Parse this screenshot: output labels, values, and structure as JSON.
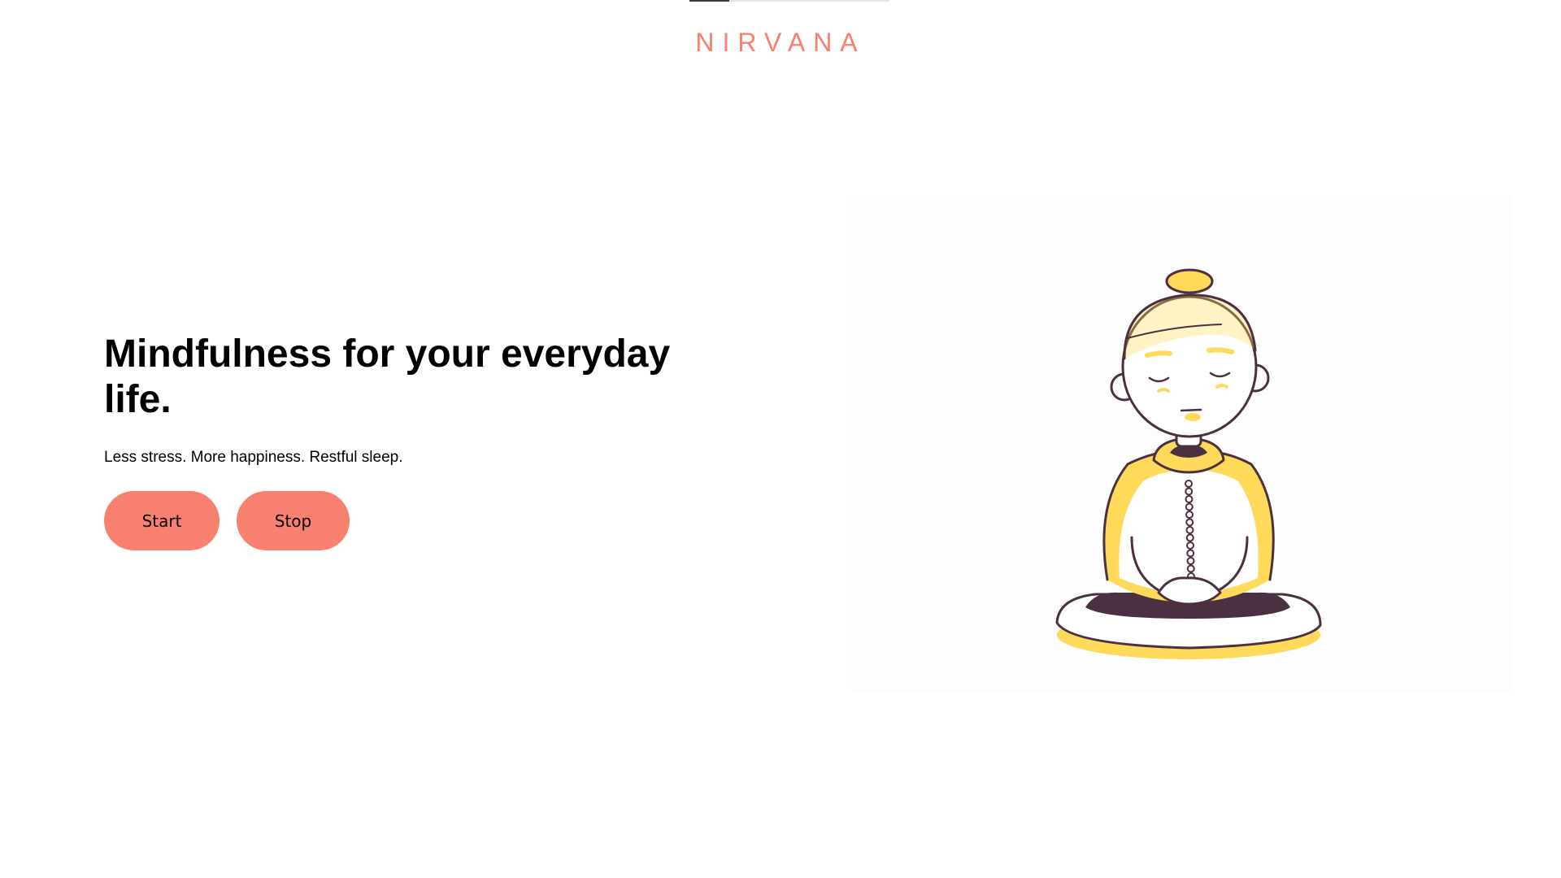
{
  "header": {
    "brand": "NIRVANA",
    "progress": 0.2
  },
  "hero": {
    "title": "Mindfulness for your everyday life.",
    "subtitle": "Less stress. More happiness. Restful sleep."
  },
  "actions": {
    "start_label": "Start",
    "stop_label": "Stop"
  },
  "illustration": {
    "icon": "meditating-person-icon"
  },
  "colors": {
    "accent": "#f88070",
    "illustration_yellow": "#ffd95a",
    "outline": "#4a3040",
    "text": "#000000"
  }
}
